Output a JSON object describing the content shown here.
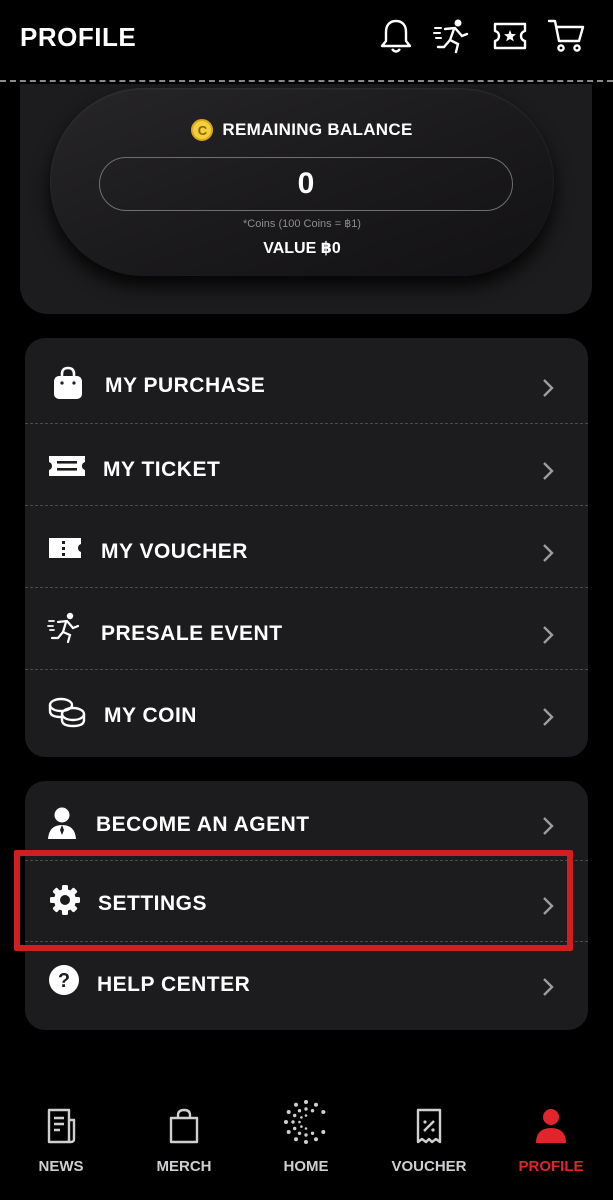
{
  "header": {
    "title": "PROFILE",
    "icons": [
      "bell-icon",
      "running-person-icon",
      "ticket-icon",
      "cart-icon"
    ]
  },
  "balance": {
    "label": "REMAINING BALANCE",
    "coin_symbol": "C",
    "value": "0",
    "note": "*Coins (100 Coins = ฿1)",
    "money": "VALUE ฿0"
  },
  "menu1": {
    "items": [
      {
        "label": "MY PURCHASE",
        "icon": "shopping-bag-icon"
      },
      {
        "label": "MY TICKET",
        "icon": "ticket-icon"
      },
      {
        "label": "MY VOUCHER",
        "icon": "voucher-icon"
      },
      {
        "label": "PRESALE EVENT",
        "icon": "running-person-icon"
      },
      {
        "label": "MY COIN",
        "icon": "coins-icon"
      }
    ]
  },
  "menu2": {
    "items": [
      {
        "label": "BECOME AN AGENT",
        "icon": "agent-icon"
      },
      {
        "label": "SETTINGS",
        "icon": "gear-icon"
      },
      {
        "label": "HELP CENTER",
        "icon": "question-icon"
      }
    ]
  },
  "tabs": [
    {
      "label": "NEWS",
      "icon": "news-icon",
      "active": false
    },
    {
      "label": "MERCH",
      "icon": "bag-icon",
      "active": false
    },
    {
      "label": "HOME",
      "icon": "home-logo-icon",
      "active": false
    },
    {
      "label": "VOUCHER",
      "icon": "voucher-receipt-icon",
      "active": false
    },
    {
      "label": "PROFILE",
      "icon": "person-icon",
      "active": true
    }
  ],
  "colors": {
    "background": "#000000",
    "card": "#1c1b1d",
    "accent_red": "#e1252c",
    "highlight_red": "#d11f1f",
    "coin_gold": "#f3cf3c"
  }
}
